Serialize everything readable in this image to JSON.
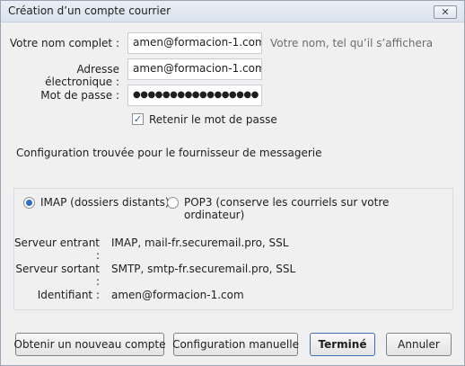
{
  "window": {
    "title": "Création d’un compte courrier",
    "close_icon": "close-icon"
  },
  "form": {
    "name_label": "Votre nom complet :",
    "name_value": "amen@formacion-1.com",
    "name_hint": "Votre nom, tel qu’il s’affichera",
    "email_label": "Adresse électronique :",
    "email_value": "amen@formacion-1.com",
    "password_label": "Mot de passe :",
    "password_value": "●●●●●●●●●●●●●●●●●",
    "remember_label": "Retenir le mot de passe",
    "remember_checked": true
  },
  "config_found_text": "Configuration trouvée pour le fournisseur de messagerie",
  "protocols": {
    "imap_label": "IMAP (dossiers distants)",
    "pop3_label": "POP3 (conserve les courriels sur votre ordinateur)",
    "selected": "IMAP"
  },
  "servers": {
    "incoming_label": "Serveur entrant :",
    "incoming_value": "IMAP, mail-fr.securemail.pro, SSL",
    "outgoing_label": "Serveur sortant :",
    "outgoing_value": "SMTP, smtp-fr.securemail.pro, SSL",
    "identifier_label": "Identifiant :",
    "identifier_value": "amen@formacion-1.com"
  },
  "buttons": {
    "new_account": "Obtenir un nouveau compte",
    "manual_config": "Configuration manuelle",
    "done": "Terminé",
    "cancel": "Annuler"
  }
}
